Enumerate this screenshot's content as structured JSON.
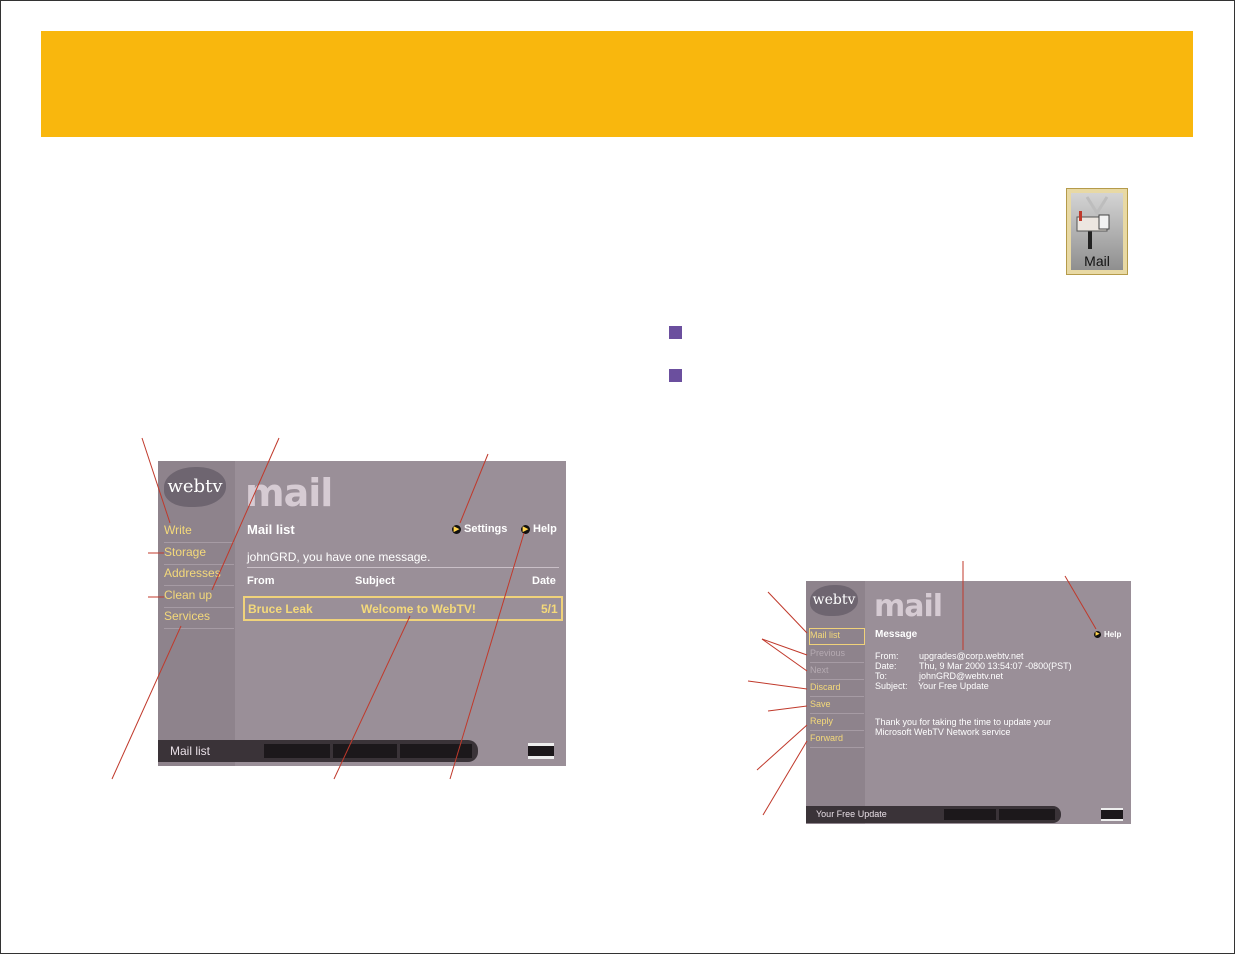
{
  "mail_icon": {
    "label": "Mail"
  },
  "screen1": {
    "logo": "webtv",
    "word": "mail",
    "nav": [
      "Write",
      "Storage",
      "Addresses",
      "Clean up",
      "Services"
    ],
    "title": "Mail list",
    "settings": "Settings",
    "help": "Help",
    "greeting": "johnGRD, you have one message.",
    "columns": [
      "From",
      "Subject",
      "Date"
    ],
    "row": {
      "from": "Bruce Leak",
      "subject": "Welcome to WebTV!",
      "date": "5/1"
    },
    "status": "Mail list"
  },
  "screen2": {
    "logo": "webtv",
    "word": "mail",
    "nav": [
      "Mail list",
      "Previous",
      "Next",
      "Discard",
      "Save",
      "Reply",
      "Forward"
    ],
    "title": "Message",
    "help": "Help",
    "header_labels": [
      "From:",
      "Date:",
      "To:",
      "Subject:"
    ],
    "header_values": [
      "upgrades@corp.webtv.net",
      "Thu, 9 Mar 2000 13:54:07 -0800(PST)",
      "johnGRD@webtv.net",
      "Your Free Update"
    ],
    "body_lines": [
      "Thank you for taking the time to update your",
      "Microsoft WebTV Network service"
    ],
    "status": "Your Free Update"
  }
}
